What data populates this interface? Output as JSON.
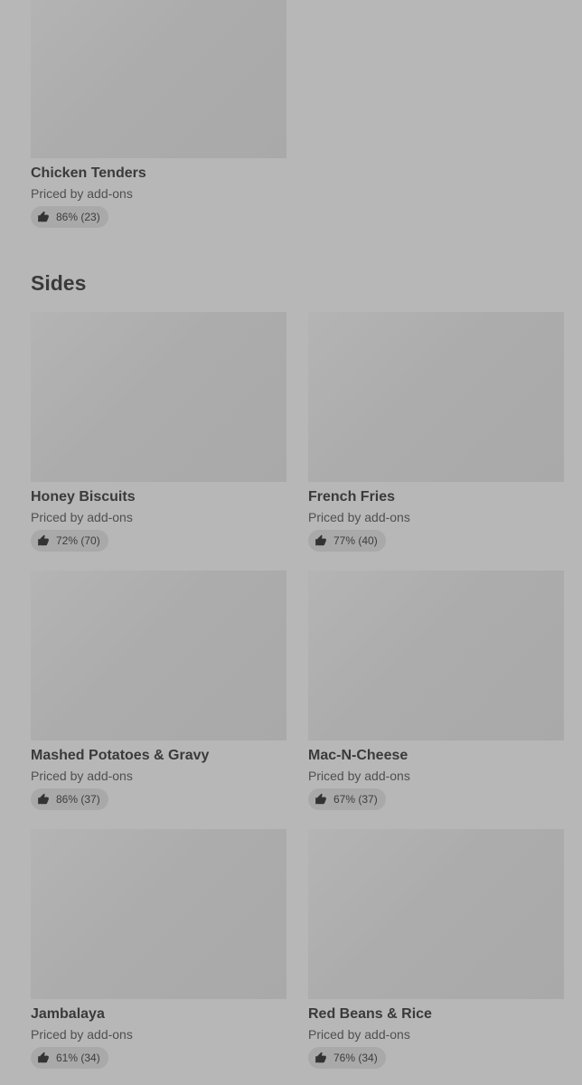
{
  "top_item": {
    "name": "Chicken Tenders",
    "price": "Priced by add-ons",
    "rating": "86% (23)"
  },
  "sides": {
    "title": "Sides",
    "items": [
      {
        "name": "Honey Biscuits",
        "price": "Priced by add-ons",
        "rating": "72% (70)"
      },
      {
        "name": "French Fries",
        "price": "Priced by add-ons",
        "rating": "77% (40)"
      },
      {
        "name": "Mashed Potatoes & Gravy",
        "price": "Priced by add-ons",
        "rating": "86% (37)"
      },
      {
        "name": "Mac-N-Cheese",
        "price": "Priced by add-ons",
        "rating": "67% (37)"
      },
      {
        "name": "Jambalaya",
        "price": "Priced by add-ons",
        "rating": "61% (34)"
      },
      {
        "name": "Red Beans & Rice",
        "price": "Priced by add-ons",
        "rating": "76% (34)"
      }
    ]
  },
  "colors": {
    "overlay_background": "#b7b7b7",
    "image_placeholder": "#acacac",
    "rating_pill": "#a9a9a9"
  },
  "icons": {
    "rating": "thumbs-up-icon"
  }
}
